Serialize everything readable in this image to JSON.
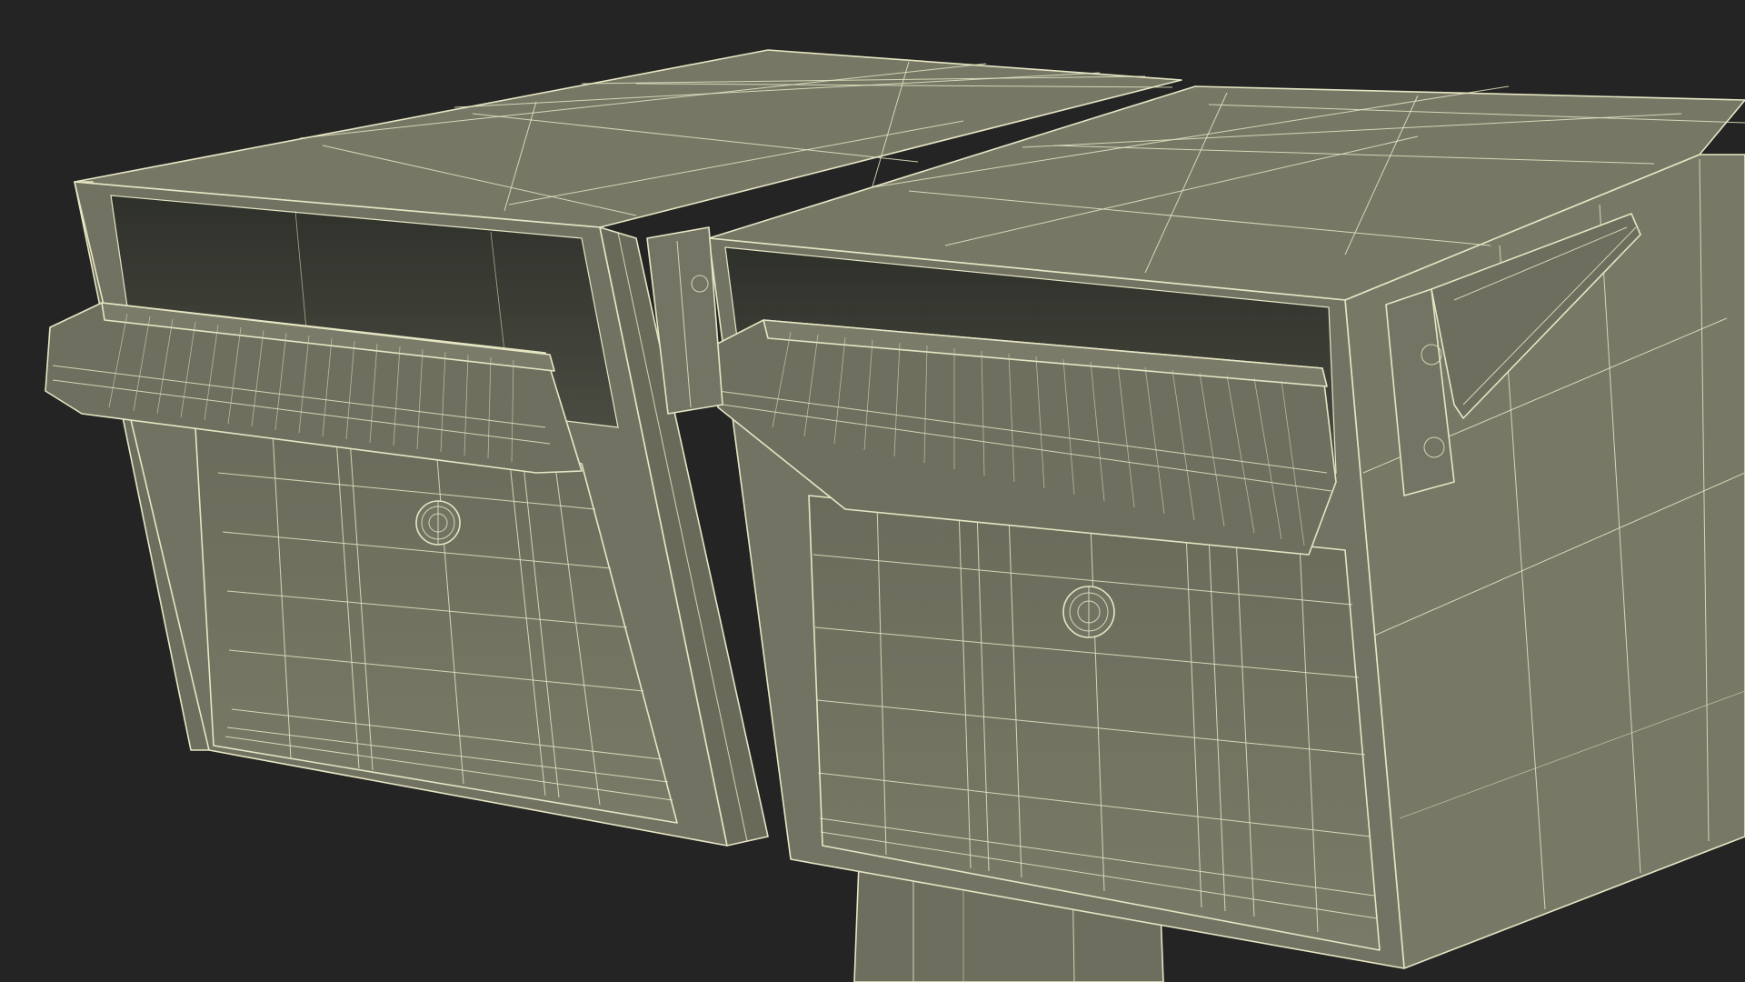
{
  "scene": {
    "subject": "mailboxes",
    "count": 2,
    "render_style": "wireframe-on-shaded",
    "background_color": "#242424",
    "surface_color": "#777766",
    "shadow_color": "#5c5c4e",
    "interior_color": "#2a2c26",
    "wire_color": "#e6e6c4"
  }
}
